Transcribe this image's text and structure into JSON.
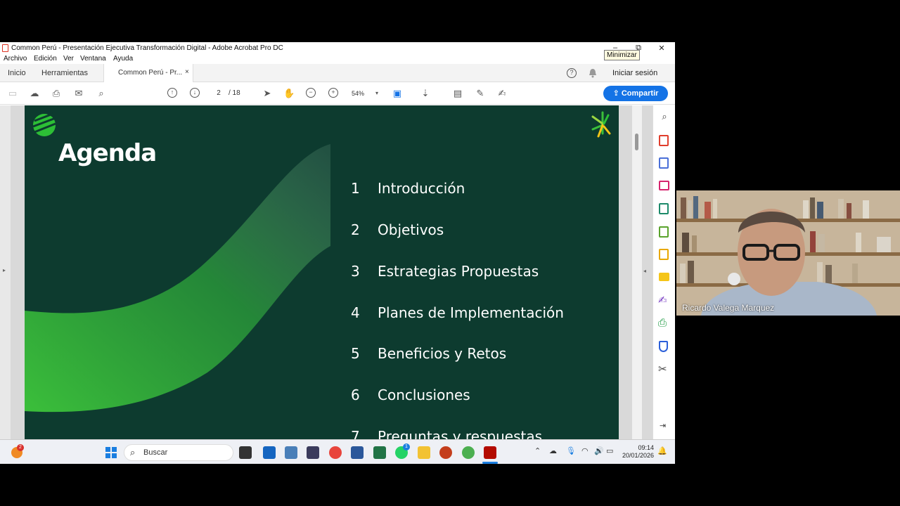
{
  "window": {
    "title": "Common Perú - Presentación Ejecutiva Transformación Digital - Adobe Acrobat Pro DC",
    "tooltip": "Minimizar",
    "minimize": "–",
    "maximize": "⧉",
    "close": "✕"
  },
  "menu": [
    "Archivo",
    "Edición",
    "Ver",
    "Ventana",
    "Ayuda"
  ],
  "tabs": {
    "home": "Inicio",
    "tools": "Herramientas",
    "document": "Common Perú - Pr...",
    "close": "×",
    "signin": "Iniciar sesión",
    "help": "?"
  },
  "toolbar": {
    "page_current": "2",
    "page_total": "/ 18",
    "zoom": "54%",
    "share": "Compartir"
  },
  "slide": {
    "title": "Agenda",
    "items": [
      {
        "num": "1",
        "label": "Introducción"
      },
      {
        "num": "2",
        "label": "Objetivos"
      },
      {
        "num": "3",
        "label": "Estrategias Propuestas"
      },
      {
        "num": "4",
        "label": "Planes de Implementación"
      },
      {
        "num": "5",
        "label": "Beneficios y Retos"
      },
      {
        "num": "6",
        "label": "Conclusiones"
      },
      {
        "num": "7",
        "label": "Preguntas y respuestas"
      }
    ]
  },
  "taskbar": {
    "search": "Buscar",
    "time": "09:14",
    "date": "20/01/2026",
    "notif_badge": "2",
    "whatsapp_badge": "1"
  },
  "video": {
    "name": "Ricardo Valega Marquez"
  },
  "colors": {
    "slide_bg": "#0d3b2f",
    "accent_green": "#3bbf3a",
    "share_blue": "#1473e6"
  }
}
